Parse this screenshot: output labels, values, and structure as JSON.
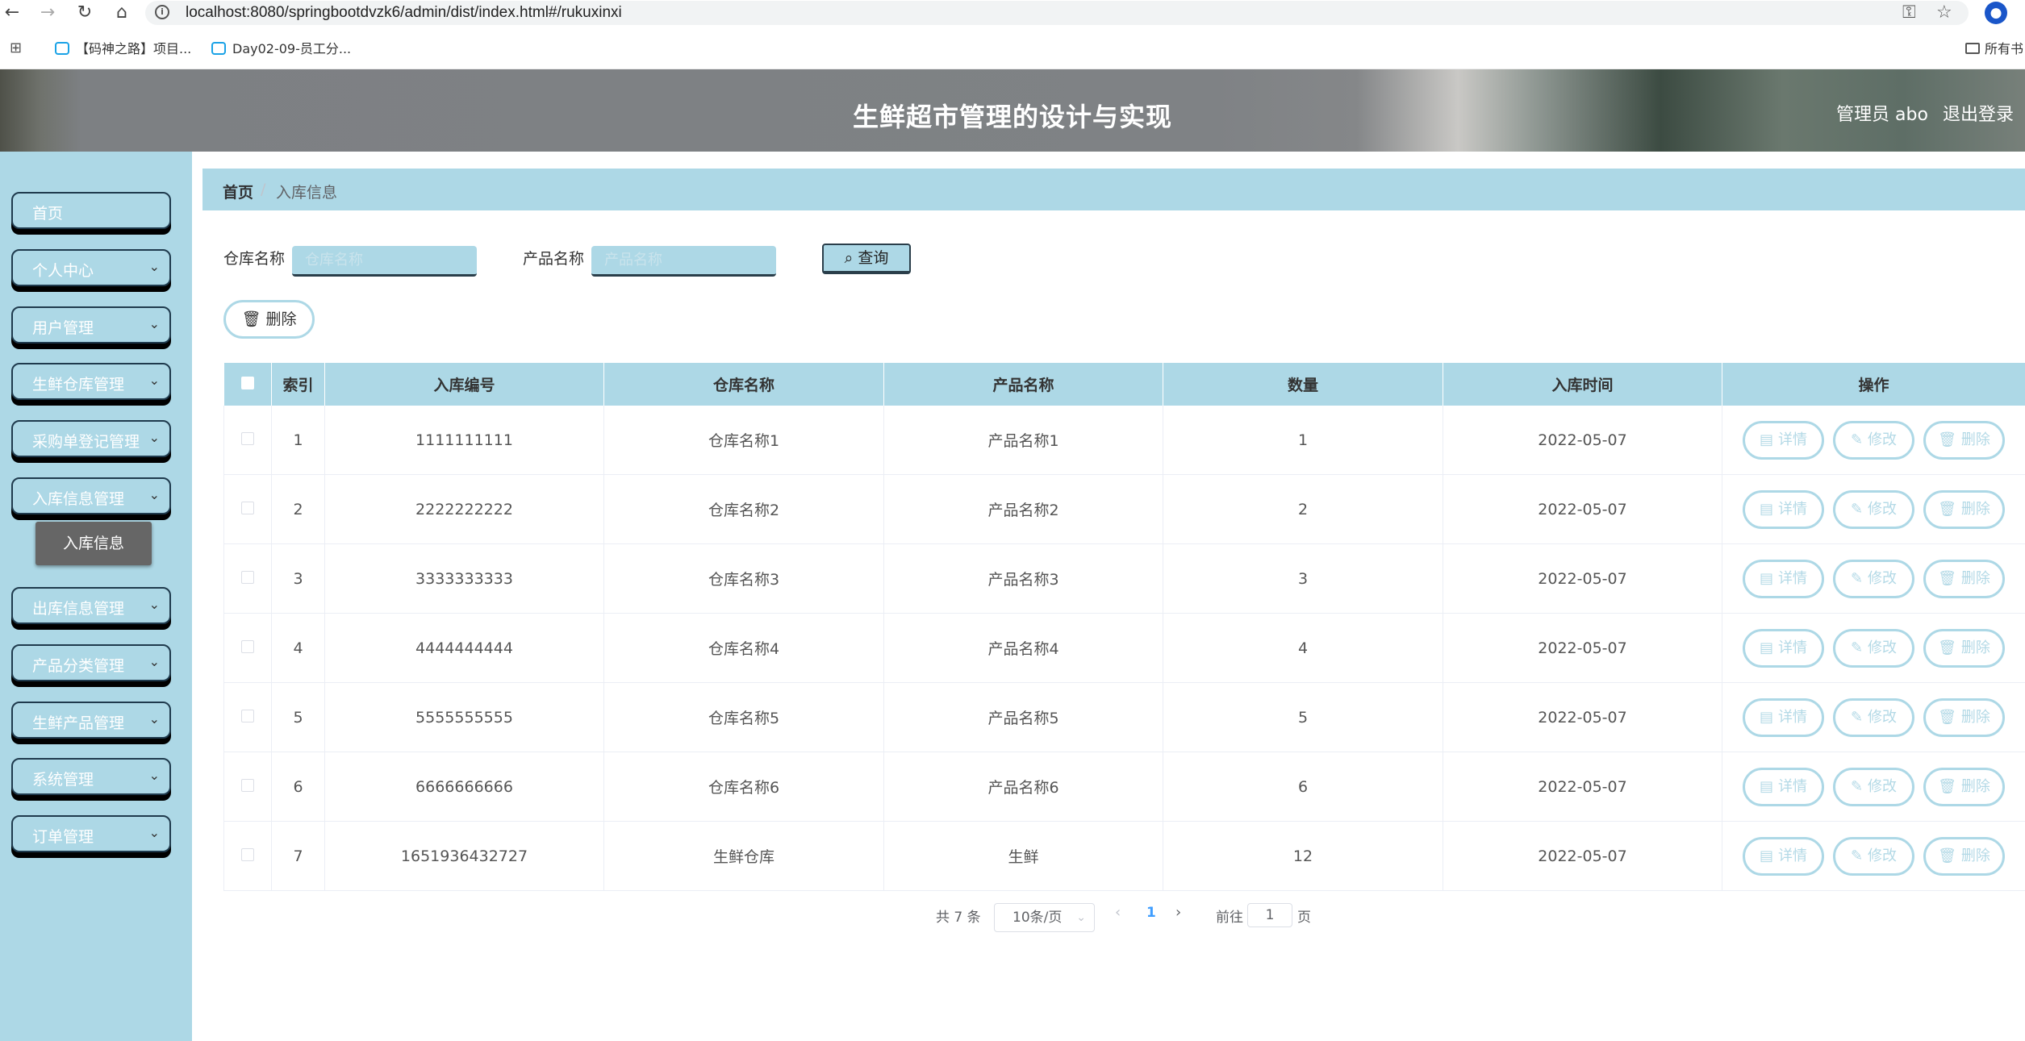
{
  "browser": {
    "url": "localhost:8080/springbootdvzk6/admin/dist/index.html#/rukuxinxi",
    "bookmarks": [
      "【码神之路】项目...",
      "Day02-09-员工分..."
    ],
    "bookmarks_folder": "所有书"
  },
  "header": {
    "title": "生鲜超市管理的设计与实现",
    "user": "管理员 abo",
    "logout": "退出登录"
  },
  "sidebar": {
    "items": [
      {
        "label": "首页",
        "chevron": ""
      },
      {
        "label": "个人中心",
        "chevron": "⌄"
      },
      {
        "label": "用户管理",
        "chevron": "⌄"
      },
      {
        "label": "生鲜仓库管理",
        "chevron": "⌄"
      },
      {
        "label": "采购单登记管理",
        "chevron": "⌄"
      },
      {
        "label": "入库信息管理",
        "chevron": "⌄"
      },
      {
        "label": "出库信息管理",
        "chevron": "⌄"
      },
      {
        "label": "产品分类管理",
        "chevron": "⌄"
      },
      {
        "label": "生鲜产品管理",
        "chevron": "⌄"
      },
      {
        "label": "系统管理",
        "chevron": "⌄"
      },
      {
        "label": "订单管理",
        "chevron": "⌄"
      }
    ],
    "submenu_active": "入库信息"
  },
  "breadcrumb": {
    "home": "首页",
    "separator": "/",
    "current": "入库信息"
  },
  "search": {
    "warehouse_label": "仓库名称",
    "warehouse_placeholder": "仓库名称",
    "warehouse_value": "",
    "product_label": "产品名称",
    "product_placeholder": "产品名称",
    "product_value": "",
    "query_button": "查询"
  },
  "actions": {
    "delete_button": "删除"
  },
  "table": {
    "headers": [
      "索引",
      "入库编号",
      "仓库名称",
      "产品名称",
      "数量",
      "入库时间",
      "操作"
    ],
    "row_buttons": {
      "detail": "详情",
      "edit": "修改",
      "delete": "删除"
    },
    "rows": [
      {
        "index": "1",
        "code": "1111111111",
        "warehouse": "仓库名称1",
        "product": "产品名称1",
        "qty": "1",
        "time": "2022-05-07"
      },
      {
        "index": "2",
        "code": "2222222222",
        "warehouse": "仓库名称2",
        "product": "产品名称2",
        "qty": "2",
        "time": "2022-05-07"
      },
      {
        "index": "3",
        "code": "3333333333",
        "warehouse": "仓库名称3",
        "product": "产品名称3",
        "qty": "3",
        "time": "2022-05-07"
      },
      {
        "index": "4",
        "code": "4444444444",
        "warehouse": "仓库名称4",
        "product": "产品名称4",
        "qty": "4",
        "time": "2022-05-07"
      },
      {
        "index": "5",
        "code": "5555555555",
        "warehouse": "仓库名称5",
        "product": "产品名称5",
        "qty": "5",
        "time": "2022-05-07"
      },
      {
        "index": "6",
        "code": "6666666666",
        "warehouse": "仓库名称6",
        "product": "产品名称6",
        "qty": "6",
        "time": "2022-05-07"
      },
      {
        "index": "7",
        "code": "1651936432727",
        "warehouse": "生鲜仓库",
        "product": "生鲜",
        "qty": "12",
        "time": "2022-05-07"
      }
    ]
  },
  "pagination": {
    "total": "共 7 条",
    "page_size": "10条/页",
    "current_page": "1",
    "goto_label": "前往",
    "goto_value": "1",
    "goto_unit": "页"
  }
}
